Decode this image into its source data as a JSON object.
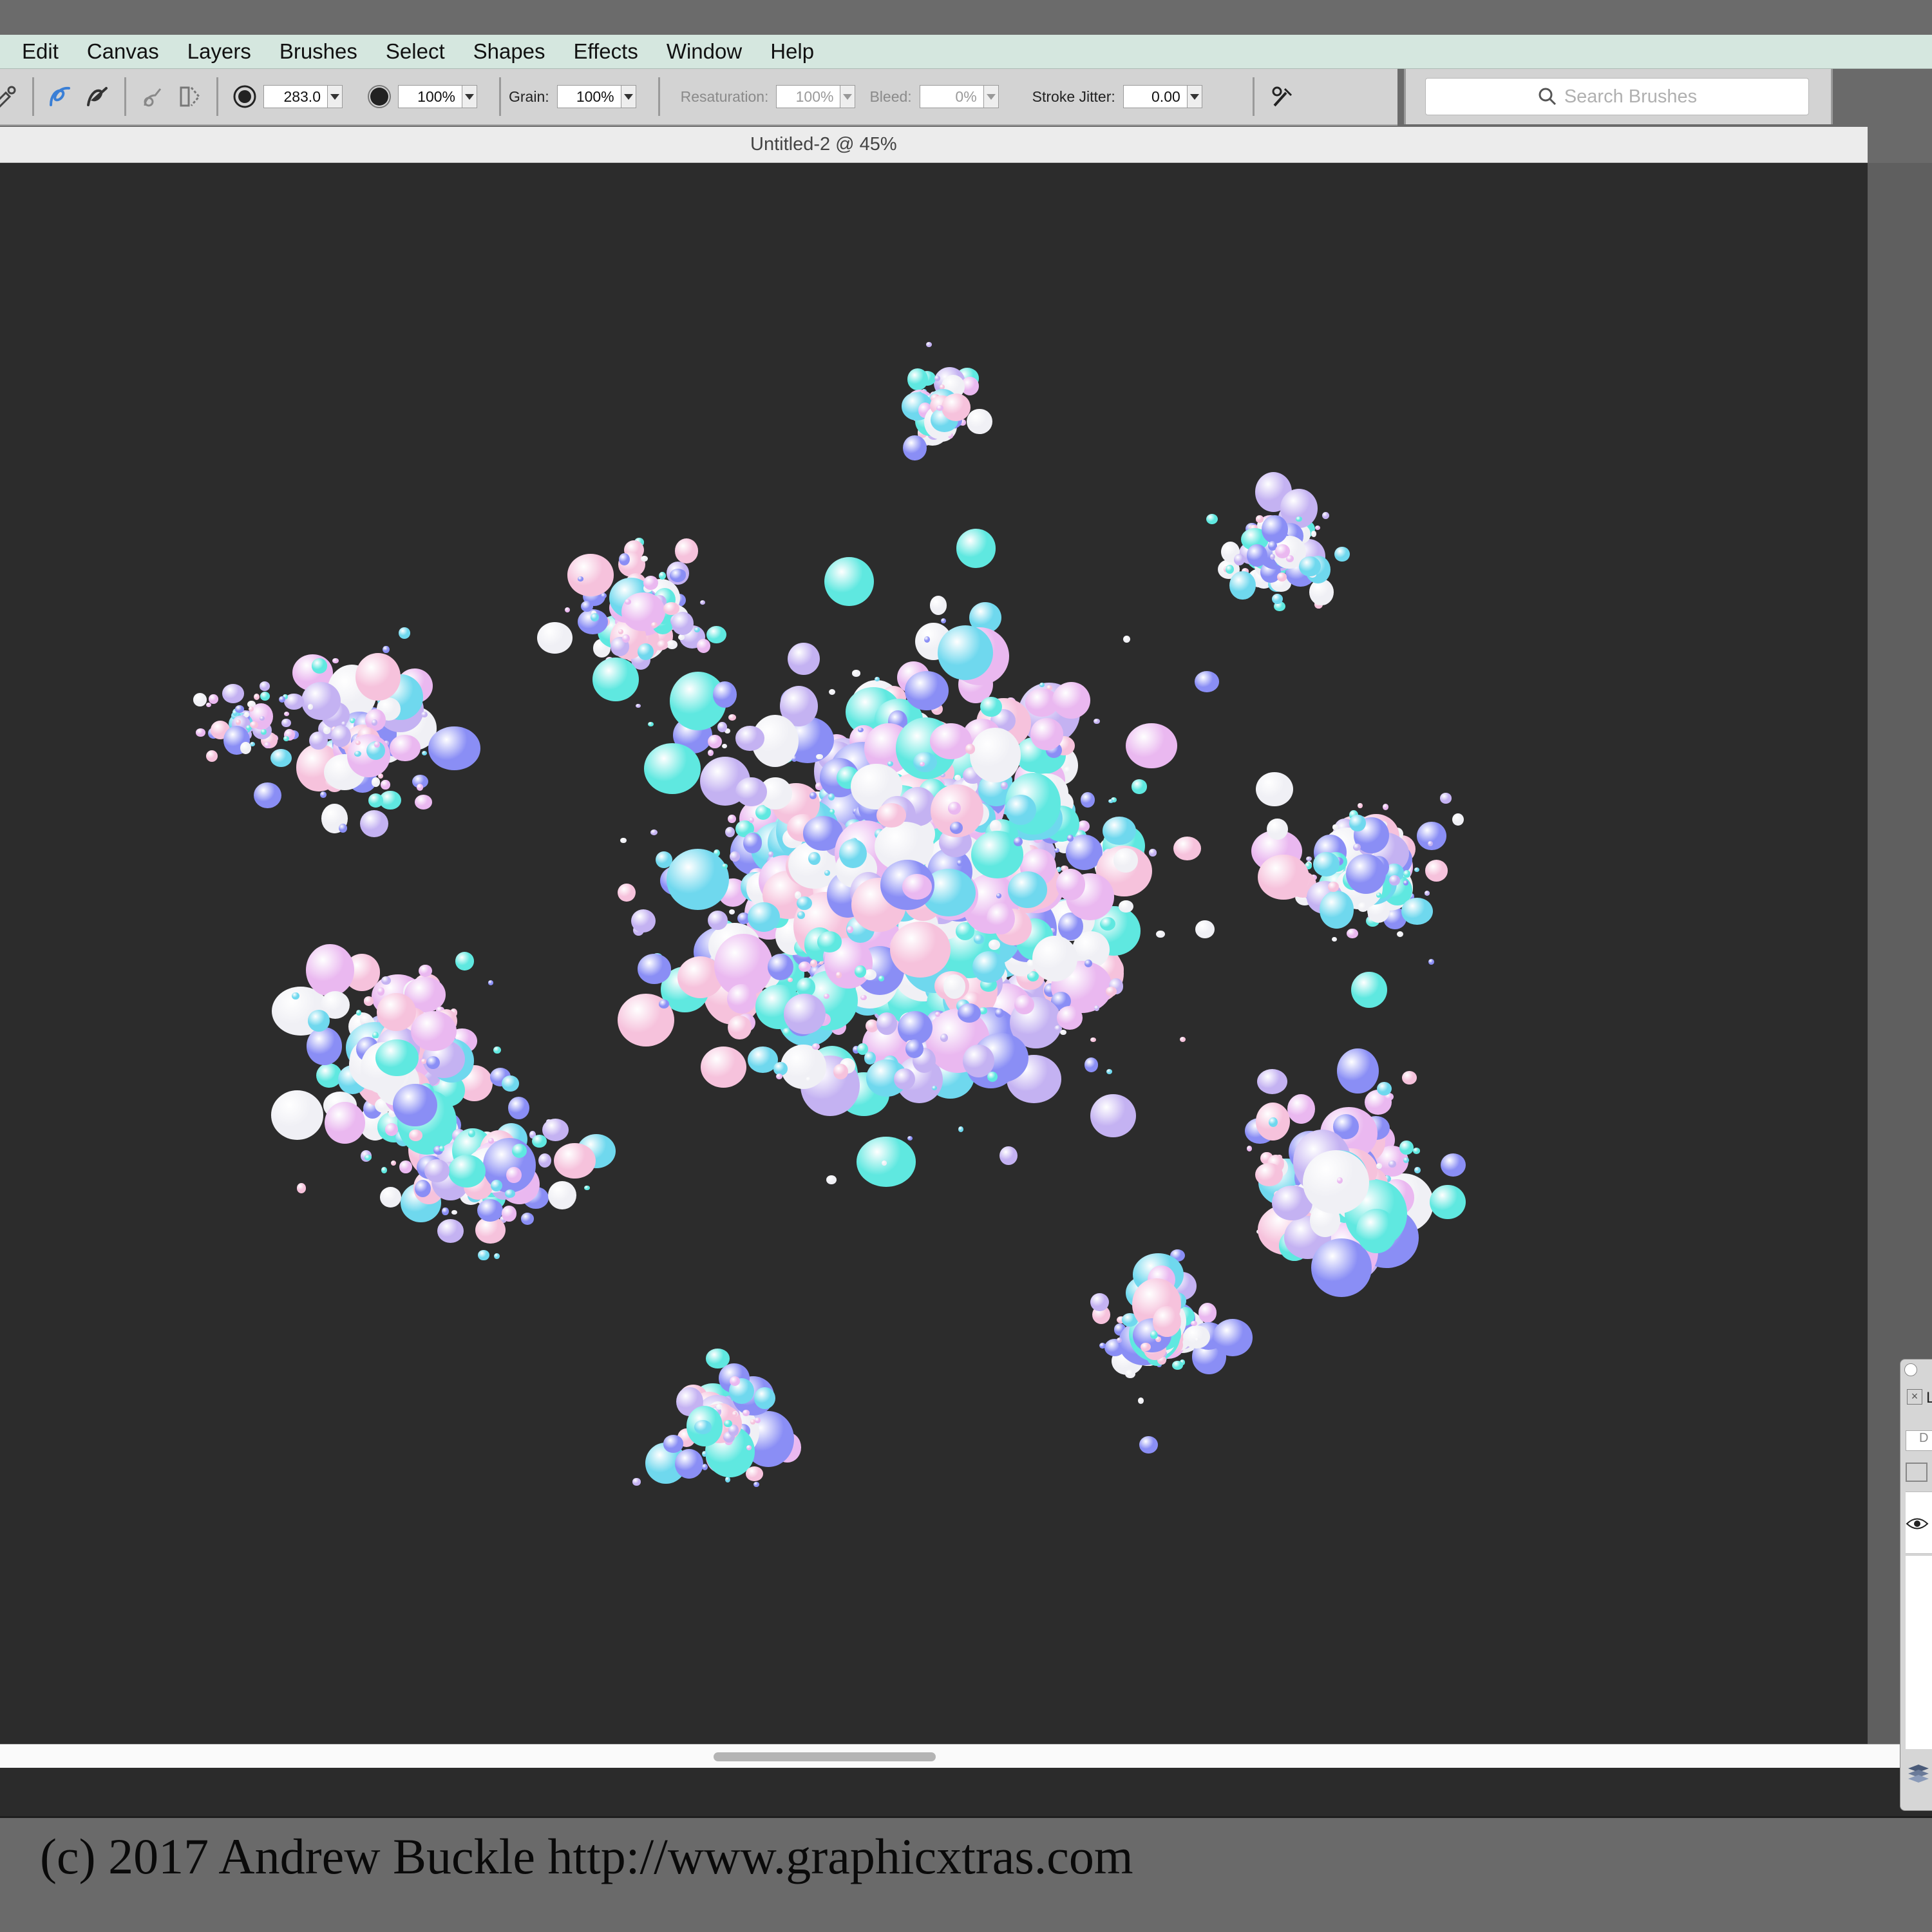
{
  "menubar": {
    "items": [
      "Edit",
      "Canvas",
      "Layers",
      "Brushes",
      "Select",
      "Shapes",
      "Effects",
      "Window",
      "Help"
    ]
  },
  "toolbar": {
    "size_value": "283.0",
    "opacity_value": "100%",
    "grain_label": "Grain:",
    "grain_value": "100%",
    "resaturation_label": "Resaturation:",
    "resaturation_value": "100%",
    "bleed_label": "Bleed:",
    "bleed_value": "0%",
    "stroke_jitter_label": "Stroke Jitter:",
    "stroke_jitter_value": "0.00",
    "search_placeholder": "Search Brushes"
  },
  "document": {
    "title": "Untitled-2 @ 45%"
  },
  "layers_panel": {
    "tab_label": "L",
    "button_label": "D"
  },
  "footer": {
    "copyright": "(c) 2017 Andrew Buckle http://www.graphicxtras.com"
  },
  "colors": {
    "canvas_bg": "#2c2c2c",
    "menubar_bg": "#d5e7df",
    "toolbar_bg": "#d3d3d3",
    "bubble_palette": [
      "#8a8ef5",
      "#5fe8e0",
      "#f0f0f5",
      "#eab8f0",
      "#f6c2dc",
      "#c4b2f2",
      "#6fd8ee"
    ]
  }
}
